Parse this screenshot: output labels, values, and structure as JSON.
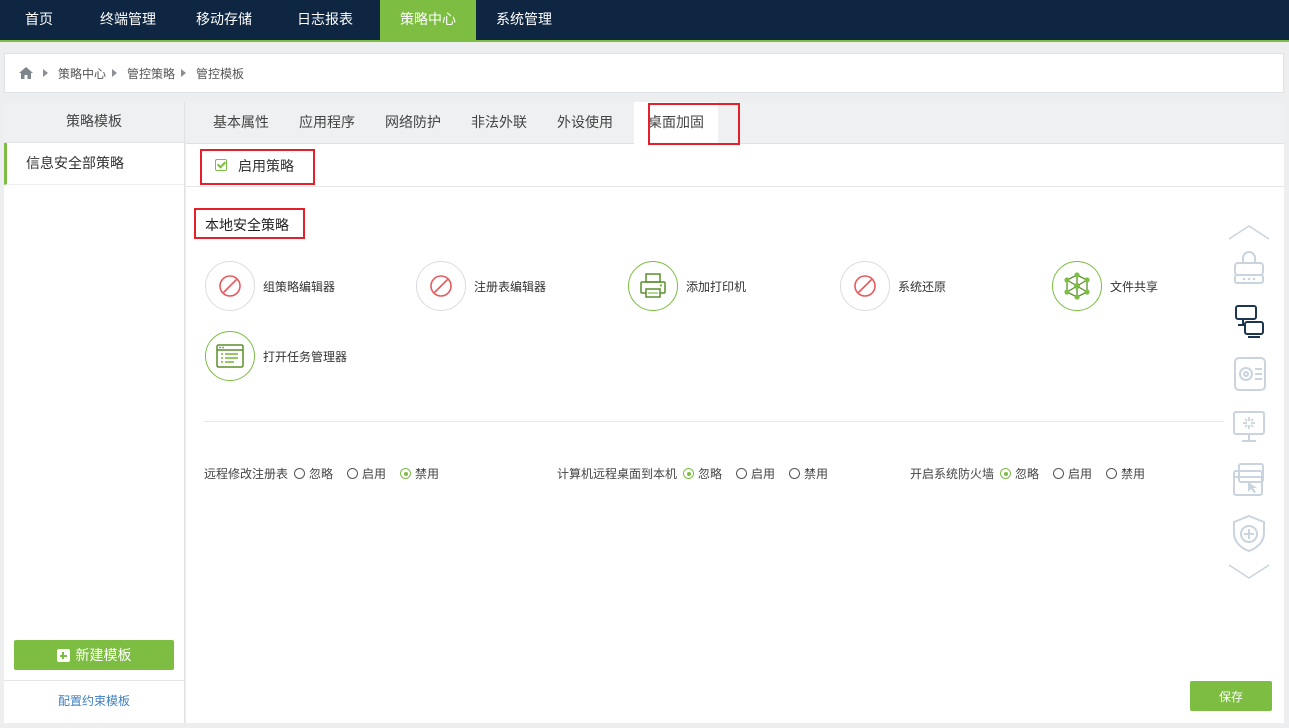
{
  "nav": {
    "items": [
      {
        "label": "首页"
      },
      {
        "label": "终端管理"
      },
      {
        "label": "移动存储"
      },
      {
        "label": "日志报表"
      },
      {
        "label": "策略中心"
      },
      {
        "label": "系统管理"
      }
    ],
    "active_index": 4
  },
  "breadcrumb": [
    "策略中心",
    "管控策略",
    "管控模板"
  ],
  "sidebar": {
    "title": "策略模板",
    "items": [
      {
        "label": "信息安全部策略"
      }
    ],
    "new_button": "新建模板",
    "config_link": "配置约束模板"
  },
  "tabs": [
    {
      "label": "基本属性"
    },
    {
      "label": "应用程序"
    },
    {
      "label": "网络防护"
    },
    {
      "label": "非法外联"
    },
    {
      "label": "外设使用"
    },
    {
      "label": "桌面加固"
    }
  ],
  "active_tab": "桌面加固",
  "enable_policy": {
    "label": "启用策略",
    "checked": true
  },
  "section_title": "本地安全策略",
  "policies": [
    {
      "label": "组策略编辑器",
      "icon": "forbidden-icon",
      "enabled": false
    },
    {
      "label": "注册表编辑器",
      "icon": "forbidden-icon",
      "enabled": false
    },
    {
      "label": "添加打印机",
      "icon": "printer-icon",
      "enabled": true
    },
    {
      "label": "系统还原",
      "icon": "forbidden-icon",
      "enabled": false
    },
    {
      "label": "文件共享",
      "icon": "network-share-icon",
      "enabled": true
    },
    {
      "label": "打开任务管理器",
      "icon": "task-manager-icon",
      "enabled": true
    }
  ],
  "radio_groups": [
    {
      "label": "远程修改注册表",
      "options": [
        "忽略",
        "启用",
        "禁用"
      ],
      "selected": "禁用"
    },
    {
      "label": "计算机远程桌面到本机",
      "options": [
        "忽略",
        "启用",
        "禁用"
      ],
      "selected": "忽略"
    },
    {
      "label": "开启系统防火墙",
      "options": [
        "忽略",
        "启用",
        "禁用"
      ],
      "selected": "忽略"
    }
  ],
  "save_button": "保存",
  "rail_icons": [
    "chevron-up-icon",
    "printer-lock-icon",
    "remote-desktop-icon",
    "settings-list-icon",
    "monitor-sparkle-icon",
    "window-cursor-icon",
    "shield-plus-icon",
    "chevron-down-icon"
  ],
  "colors": {
    "accent": "#7cbd42",
    "nav_bg": "#0f2642",
    "highlight": "#e5202a",
    "link": "#3d7fc1"
  }
}
